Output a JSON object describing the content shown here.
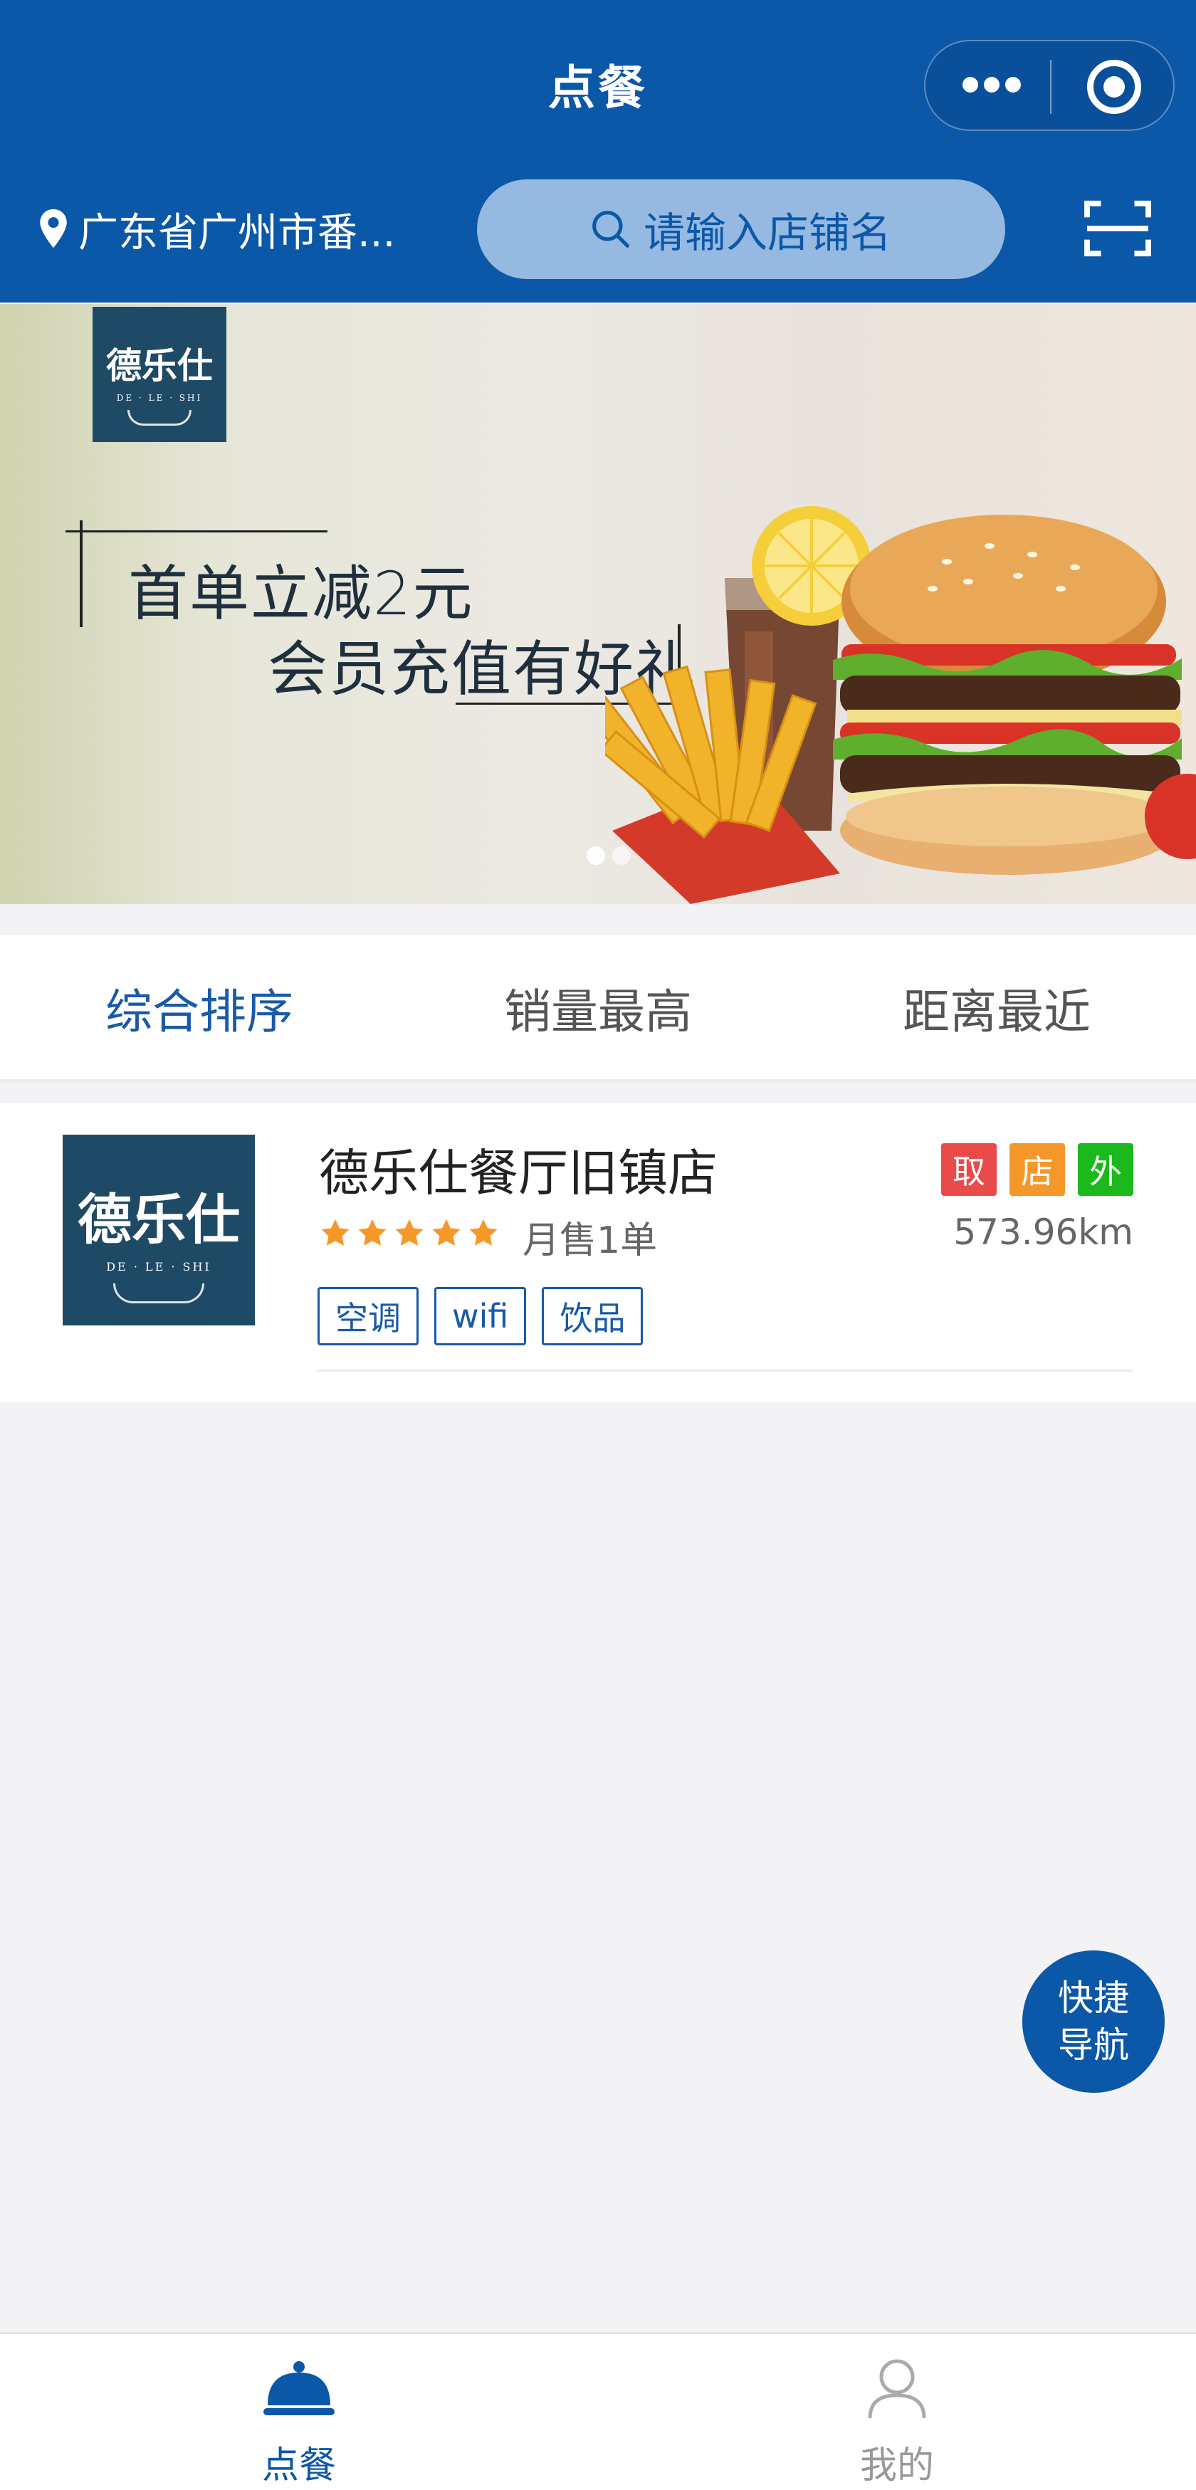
{
  "header": {
    "title": "点餐",
    "location": "广东省广州市番...",
    "search_placeholder": "请输入店铺名"
  },
  "banner": {
    "brand_logo": {
      "cn": "德乐仕",
      "en": "DE · LE · SHI"
    },
    "promo_line1": "首单立减2元",
    "promo_line2": "会员充值有好礼",
    "carousel_pages": 2,
    "carousel_active": 1
  },
  "sort_tabs": [
    {
      "label": "综合排序",
      "active": true
    },
    {
      "label": "销量最高",
      "active": false
    },
    {
      "label": "距离最近",
      "active": false
    }
  ],
  "shop": {
    "name": "德乐仕餐厅旧镇店",
    "logo": {
      "cn": "德乐仕",
      "en": "DE · LE · SHI"
    },
    "rating": 5,
    "monthly_sales": "月售1单",
    "distance": "573.96km",
    "badges": [
      {
        "label": "取",
        "color": "#e94b4b"
      },
      {
        "label": "店",
        "color": "#f6972a"
      },
      {
        "label": "外",
        "color": "#1bb91b"
      }
    ],
    "tags": [
      "空调",
      "wifi",
      "饮品"
    ]
  },
  "fab": {
    "line1": "快捷",
    "line2": "导航"
  },
  "tabbar": [
    {
      "label": "点餐",
      "icon": "cloche-icon",
      "active": true
    },
    {
      "label": "我的",
      "icon": "user-icon",
      "active": false
    }
  ],
  "colors": {
    "primary": "#0b57a8",
    "star": "#f6972a",
    "background": "#f3f3f5"
  }
}
